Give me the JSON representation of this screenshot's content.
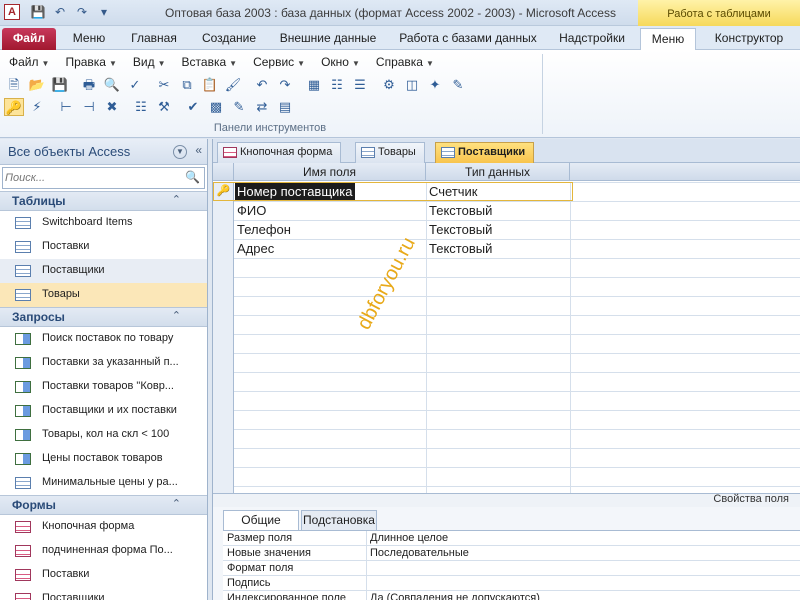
{
  "window": {
    "title": "Оптовая база 2003 : база данных (формат Access 2002 - 2003)  -  Microsoft Access",
    "context_tab_title": "Работа с таблицами",
    "app_icon_letter": "A"
  },
  "ribbon": {
    "tabs": [
      "Файл",
      "Меню",
      "Главная",
      "Создание",
      "Внешние данные",
      "Работа с базами данных",
      "Надстройки",
      "Меню",
      "Конструктор"
    ],
    "menubar": [
      "Файл",
      "Правка",
      "Вид",
      "Вставка",
      "Сервис",
      "Окно",
      "Справка"
    ],
    "group_label": "Панели инструментов"
  },
  "nav": {
    "title": "Все объекты Access",
    "search_placeholder": "Поиск...",
    "sections": [
      {
        "label": "Таблицы",
        "items": [
          "Switchboard Items",
          "Поставки",
          "Поставщики",
          "Товары"
        ]
      },
      {
        "label": "Запросы",
        "items": [
          "Поиск поставок по товару",
          "Поставки за указанный п...",
          "Поставки товаров \"Ковр...",
          "Поставщики и их поставки",
          "Товары, кол на скл < 100",
          "Цены поставок товаров",
          "Минимальные цены у ра..."
        ]
      },
      {
        "label": "Формы",
        "items": [
          "Кнопочная форма",
          "подчиненная форма По...",
          "Поставки",
          "Поставщики"
        ]
      }
    ]
  },
  "document": {
    "tabs": [
      "Кнопочная форма",
      "Товары",
      "Поставщики"
    ],
    "columns": {
      "name": "Имя поля",
      "type": "Тип данных"
    },
    "fields": [
      {
        "name": "Номер поставщика",
        "type": "Счетчик"
      },
      {
        "name": "ФИО",
        "type": "Текстовый"
      },
      {
        "name": "Телефон",
        "type": "Текстовый"
      },
      {
        "name": "Адрес",
        "type": "Текстовый"
      }
    ],
    "watermark": "dbforyou.ru"
  },
  "properties": {
    "title": "Свойства поля",
    "tabs": [
      "Общие",
      "Подстановка"
    ],
    "rows": [
      {
        "key": "Размер поля",
        "value": "Длинное целое"
      },
      {
        "key": "Новые значения",
        "value": "Последовательные"
      },
      {
        "key": "Формат поля",
        "value": ""
      },
      {
        "key": "Подпись",
        "value": ""
      },
      {
        "key": "Индексированное поле",
        "value": "Да (Совпадения не допускаются)"
      }
    ]
  },
  "colors": {
    "file_tab": "#a1182f",
    "context_tab": "#f6d95b",
    "selected_nav_item": "#fbe7b8",
    "watermark": "#e6a000"
  }
}
